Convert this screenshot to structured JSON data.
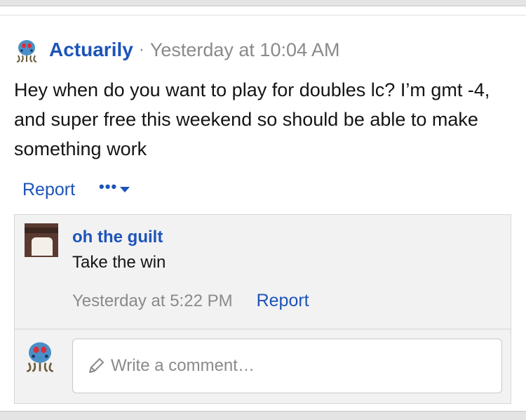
{
  "post": {
    "author": "Actuarily",
    "separator": "·",
    "timestamp": "Yesterday at 10:04 AM",
    "body": "Hey when do you want to play for doubles lc? I’m gmt -4, and super free this weekend so should be able to make something work",
    "report_label": "Report",
    "more_label": "•••"
  },
  "comments": [
    {
      "author": "oh the guilt",
      "text": "Take the win",
      "timestamp": "Yesterday at 5:22 PM",
      "report_label": "Report"
    }
  ],
  "composer": {
    "placeholder": "Write a comment…"
  },
  "colors": {
    "link": "#1d54b8",
    "muted": "#8a8a8a",
    "text": "#141414"
  },
  "icons": {
    "post_avatar": "tentacool-avatar-icon",
    "more_caret": "caret-down-icon",
    "pencil": "pencil-icon"
  }
}
